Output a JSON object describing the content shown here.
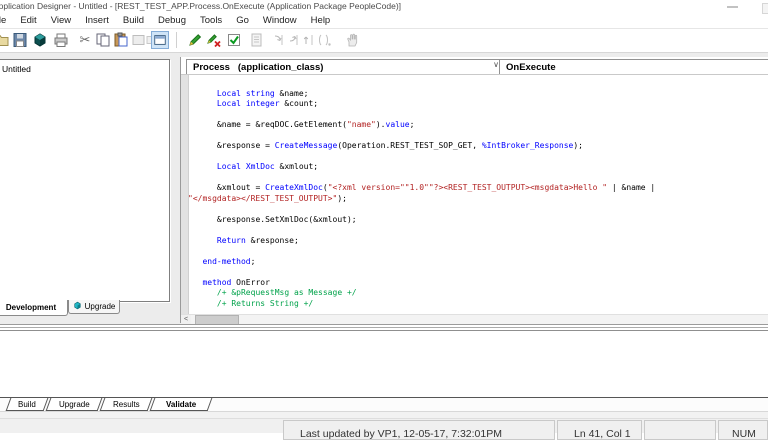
{
  "window": {
    "title": "Application Designer - Untitled - [REST_TEST_APP.Process.OnExecute (Application Package PeopleCode)]"
  },
  "menu": {
    "items": [
      "File",
      "Edit",
      "View",
      "Insert",
      "Build",
      "Debug",
      "Tools",
      "Go",
      "Window",
      "Help"
    ]
  },
  "toolbar": {
    "icons": [
      "open-project",
      "save",
      "project-cube",
      "print",
      "cut",
      "copy",
      "paste",
      "properties-disabled",
      "small-disabled",
      "window-toggle-selected",
      "edit-peoplecode-pencil",
      "delete-peoplecode-pencil-x",
      "validate-checkbox",
      "format-document-disabled",
      "step-into-disabled",
      "step-over-disabled",
      "step-out-disabled",
      "run-to-cursor-disabled",
      "stop-hand-disabled"
    ]
  },
  "project_panel": {
    "root": "Untitled",
    "tabs": [
      {
        "label": "Development",
        "active": true
      },
      {
        "label": "Upgrade",
        "active": false
      }
    ]
  },
  "editor": {
    "scope_dropdown": "Process   (application_class)",
    "event_dropdown": "OnExecute",
    "scrollbar_left_arrow": "<",
    "dropdown_chevron": "∨",
    "code": {
      "lines": [
        {
          "ind": 0,
          "segs": []
        },
        {
          "ind": 6,
          "segs": [
            [
              "k",
              "Local"
            ],
            [
              "p",
              " "
            ],
            [
              "k",
              "string"
            ],
            [
              "p",
              " &name;"
            ]
          ]
        },
        {
          "ind": 6,
          "segs": [
            [
              "k",
              "Local"
            ],
            [
              "p",
              " "
            ],
            [
              "k",
              "integer"
            ],
            [
              "p",
              " &count;"
            ]
          ]
        },
        {
          "ind": 0,
          "segs": []
        },
        {
          "ind": 6,
          "segs": [
            [
              "p",
              "&name = &reqDOC.GetElement("
            ],
            [
              "s",
              "\"name\""
            ],
            [
              "p",
              ")."
            ],
            [
              "k",
              "value"
            ],
            [
              "p",
              ";"
            ]
          ]
        },
        {
          "ind": 0,
          "segs": []
        },
        {
          "ind": 6,
          "segs": [
            [
              "p",
              "&response = "
            ],
            [
              "k",
              "CreateMessage"
            ],
            [
              "p",
              "(Operation.REST_TEST_SOP_GET, "
            ],
            [
              "k",
              "%IntBroker_Response"
            ],
            [
              "p",
              ");"
            ]
          ]
        },
        {
          "ind": 0,
          "segs": []
        },
        {
          "ind": 6,
          "segs": [
            [
              "k",
              "Local"
            ],
            [
              "p",
              " "
            ],
            [
              "k",
              "XmlDoc"
            ],
            [
              "p",
              " &xmlout;"
            ]
          ]
        },
        {
          "ind": 0,
          "segs": []
        },
        {
          "ind": 6,
          "segs": [
            [
              "p",
              "&xmlout = "
            ],
            [
              "k",
              "CreateXmlDoc"
            ],
            [
              "p",
              "("
            ],
            [
              "s",
              "\"<?xml version=\"\"1.0\"\"?><REST_TEST_OUTPUT><msgdata>Hello \""
            ],
            [
              "p",
              " | &name |"
            ]
          ]
        },
        {
          "ind": 0,
          "segs": [
            [
              "s",
              "\"</msgdata></REST_TEST_OUTPUT>\""
            ],
            [
              "p",
              ");"
            ]
          ]
        },
        {
          "ind": 0,
          "segs": []
        },
        {
          "ind": 6,
          "segs": [
            [
              "p",
              "&response.SetXmlDoc(&xmlout);"
            ]
          ]
        },
        {
          "ind": 0,
          "segs": []
        },
        {
          "ind": 6,
          "segs": [
            [
              "k",
              "Return"
            ],
            [
              "p",
              " &response;"
            ]
          ]
        },
        {
          "ind": 0,
          "segs": []
        },
        {
          "ind": 3,
          "segs": [
            [
              "k",
              "end-method"
            ],
            [
              "p",
              ";"
            ]
          ]
        },
        {
          "ind": 0,
          "segs": []
        },
        {
          "ind": 3,
          "segs": [
            [
              "k",
              "method"
            ],
            [
              "p",
              " OnError"
            ]
          ]
        },
        {
          "ind": 6,
          "segs": [
            [
              "c",
              "/+ &pRequestMsg as Message +/"
            ]
          ]
        },
        {
          "ind": 6,
          "segs": [
            [
              "c",
              "/+ Returns String +/"
            ]
          ]
        }
      ]
    }
  },
  "output": {
    "tabs": [
      {
        "label": "Build",
        "active": false
      },
      {
        "label": "Upgrade",
        "active": false
      },
      {
        "label": "Results",
        "active": false
      },
      {
        "label": "Validate",
        "active": true
      }
    ]
  },
  "status_bar": {
    "message": "Last updated by VP1, 12-05-17, 7:32:01PM",
    "position": "Ln 41, Col 1",
    "num_lock": "NUM"
  },
  "colors": {
    "keyword": "#0000ff",
    "string": "#b22222",
    "comment": "#00a24a",
    "plain": "#000000",
    "selected_toolbar_bg": "#cfe4f7",
    "selected_toolbar_border": "#84acd7",
    "workspace_bg": "#ececec"
  }
}
